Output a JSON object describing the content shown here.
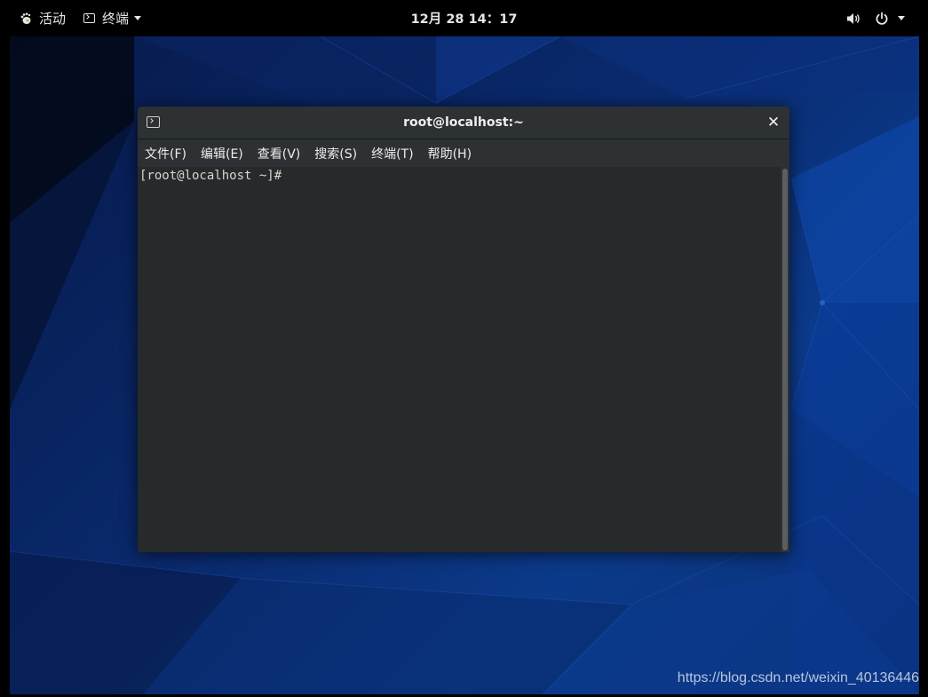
{
  "topbar": {
    "activities_label": "活动",
    "app_menu_label": "终端",
    "clock": "12月 28 14：17"
  },
  "window": {
    "title": "root@localhost:~",
    "close_glyph": "✕",
    "menu": [
      {
        "label": "文件(F)"
      },
      {
        "label": "编辑(E)"
      },
      {
        "label": "查看(V)"
      },
      {
        "label": "搜索(S)"
      },
      {
        "label": "终端(T)"
      },
      {
        "label": "帮助(H)"
      }
    ],
    "prompt": "[root@localhost ~]#"
  },
  "watermark": "https://blog.csdn.net/weixin_40136446",
  "icons": [
    "gnome-foot-icon",
    "terminal-icon",
    "chevron-down-icon",
    "volume-icon",
    "power-icon",
    "close-icon"
  ],
  "colors": {
    "topbar_bg": "#000000",
    "desktop_blue": "#0a2f75",
    "window_bg": "#2d3133",
    "terminal_bg": "#262a2b",
    "terminal_text": "#d3d7cf"
  }
}
